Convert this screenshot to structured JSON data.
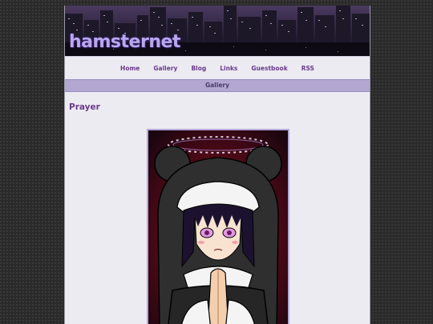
{
  "site": {
    "logo": "hamsternet"
  },
  "nav": [
    "Home",
    "Gallery",
    "Blog",
    "Links",
    "Guestbook",
    "RSS"
  ],
  "section": {
    "title": "Gallery"
  },
  "post": {
    "title": "Prayer"
  },
  "colors": {
    "accent": "#6a3a8c",
    "bar": "#b3a6d0",
    "page": "#ecebf2"
  }
}
